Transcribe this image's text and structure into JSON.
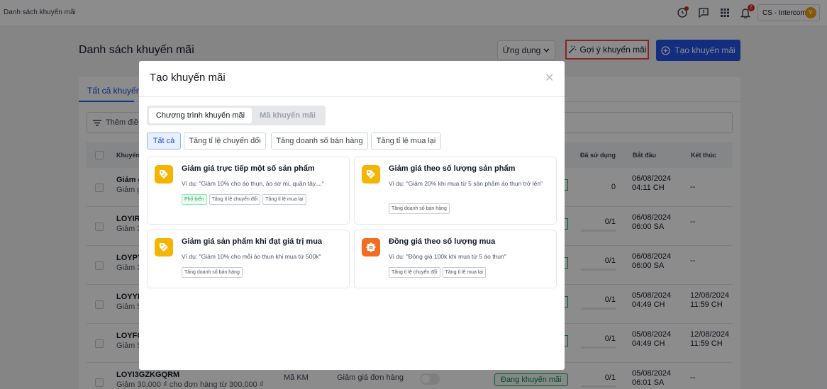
{
  "topbar": {
    "breadcrumb": "Danh sách khuyến mãi",
    "notification_count": "2",
    "shop_name": "CS - Intercom",
    "avatar_letter": "V"
  },
  "page": {
    "title": "Danh sách khuyến mãi",
    "app_button": "Ứng dụng",
    "suggest_button": "Gợi ý khuyến mãi",
    "create_button": "Tạo khuyến mãi"
  },
  "tabs": {
    "all": "Tất cả khuyến"
  },
  "filter": {
    "label": "Thêm điề"
  },
  "table": {
    "columns": {
      "name": "Khuyến",
      "used": "Đã sử dụng",
      "start": "Bắt đầu",
      "end": "Kết thúc"
    },
    "rows": [
      {
        "code": "Giảm g",
        "desc": "Giảm g",
        "used": "0",
        "start": "06/08/2024\n04:11 CH",
        "end": "--"
      },
      {
        "code": "LOYIR",
        "desc": "Giảm 3",
        "used": "0/1",
        "start": "06/08/2024\n06:00 SA",
        "end": "--"
      },
      {
        "code": "LOYPY",
        "desc": "Giảm 3",
        "used": "0/1",
        "start": "06/08/2024\n06:00 SA",
        "end": "--"
      },
      {
        "code": "LOYYD",
        "desc": "Giảm 5",
        "used": "0/1",
        "start": "05/08/2024\n04:49 CH",
        "end": "12/08/2024\n11:59 CH"
      },
      {
        "code": "LOYFO",
        "desc": "Giảm 5",
        "used": "0/1",
        "start": "05/08/2024\n04:49 CH",
        "end": "12/08/2024\n11:59 CH"
      },
      {
        "code": "LOYI3GZKGQRM",
        "desc": "Giảm 30,000 ₫ cho đơn hàng từ 300,000 ₫",
        "type": "Mã KM",
        "kind": "Giảm giá đơn hàng",
        "status": "Đang khuyến mãi",
        "used": "0/1",
        "start": "05/08/2024\n06:01 SA",
        "end": "--"
      }
    ]
  },
  "modal": {
    "title": "Tạo khuyến mãi",
    "segments": [
      "Chương trình khuyến mãi",
      "Mã khuyến mãi"
    ],
    "chips": [
      "Tất cả",
      "Tăng tỉ lệ chuyển đổi",
      "Tăng doanh số bán hàng",
      "Tăng tỉ lệ mua lại"
    ],
    "cards": [
      {
        "title": "Giảm giá trực tiếp một số sản phẩm",
        "desc": "Ví dụ: \"Giảm 10% cho áo thun, áo sơ mi, quần tây,...\"",
        "tags": [
          "Phổ biến",
          "Tăng tỉ lệ chuyển đổi",
          "Tăng tỉ lệ mua lại"
        ],
        "icon": "tag-icon"
      },
      {
        "title": "Giảm giá theo số lượng sản phẩm",
        "desc": "Ví dụ: \"Giảm 20% khi mua từ 5 sản phẩm áo thun trở lên\"",
        "tags": [
          "Tăng doanh số bán hàng"
        ],
        "icon": "tag-icon"
      },
      {
        "title": "Giảm giá sản phẩm khi đạt giá trị mua",
        "desc": "Ví dụ: \"Giảm 10% cho mỗi áo thun khi mua từ 500k\"",
        "tags": [
          "Tăng doanh số bán hàng"
        ],
        "icon": "tag-icon"
      },
      {
        "title": "Đồng giá theo số lượng mua",
        "desc": "Ví dụ: \"Đồng giá 100k khi mua từ 5 áo thun\"",
        "tags": [
          "Tăng tỉ lệ chuyển đổi",
          "Tăng tỉ lệ mua lại"
        ],
        "icon": "equal-tag-icon"
      }
    ]
  },
  "colors": {
    "primary": "#2455e6",
    "highlight": "#ef4444",
    "success": "#16a34a",
    "tag_yellow": "#f5b400",
    "tag_orange": "#f26d21"
  }
}
